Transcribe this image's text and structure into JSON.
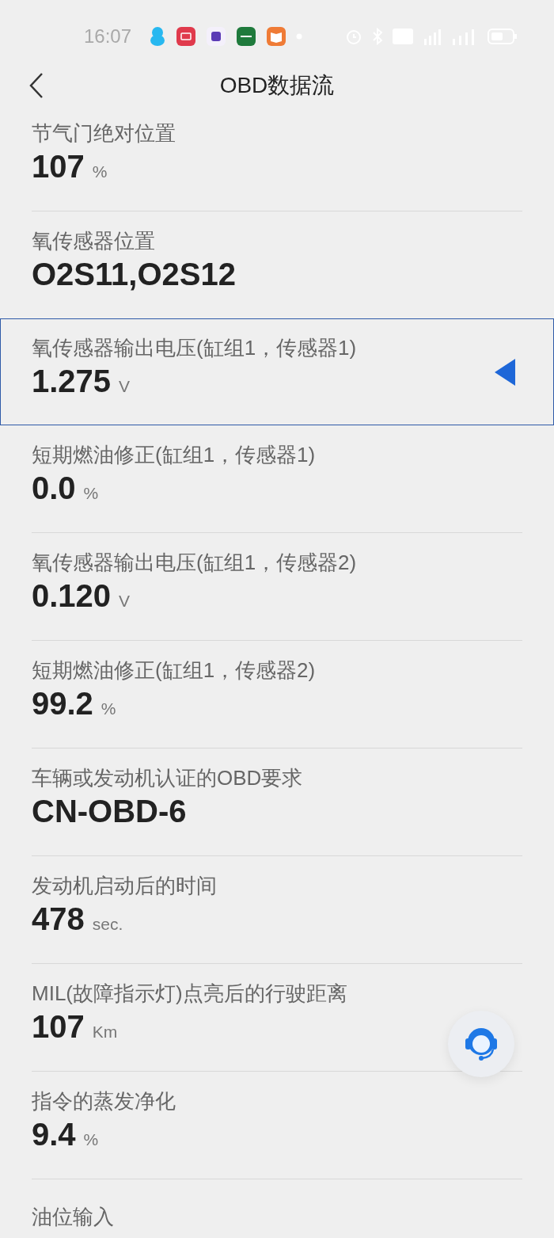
{
  "status_bar": {
    "time": "16:07"
  },
  "header": {
    "title": "OBD数据流"
  },
  "items": [
    {
      "label": "节气门绝对位置",
      "value": "107",
      "unit": "%",
      "selected": false
    },
    {
      "label": "氧传感器位置",
      "value": "O2S11,O2S12",
      "selected": false
    },
    {
      "label": "氧传感器输出电压(缸组1，传感器1)",
      "value": "1.275",
      "unit": "V",
      "selected": true
    },
    {
      "label": "短期燃油修正(缸组1，传感器1)",
      "value": "0.0",
      "unit": "%",
      "selected": false
    },
    {
      "label": "氧传感器输出电压(缸组1，传感器2)",
      "value": "0.120",
      "unit": "V",
      "selected": false
    },
    {
      "label": "短期燃油修正(缸组1，传感器2)",
      "value": "99.2",
      "unit": "%",
      "selected": false
    },
    {
      "label": "车辆或发动机认证的OBD要求",
      "value": "CN-OBD-6",
      "selected": false
    },
    {
      "label": "发动机启动后的时间",
      "value": "478",
      "unit": "sec.",
      "selected": false
    },
    {
      "label": "MIL(故障指示灯)点亮后的行驶距离",
      "value": "107",
      "unit": "Km",
      "selected": false
    },
    {
      "label": "指令的蒸发净化",
      "value": "9.4",
      "unit": "%",
      "selected": false
    },
    {
      "label": "油位输入",
      "selected": false
    }
  ]
}
